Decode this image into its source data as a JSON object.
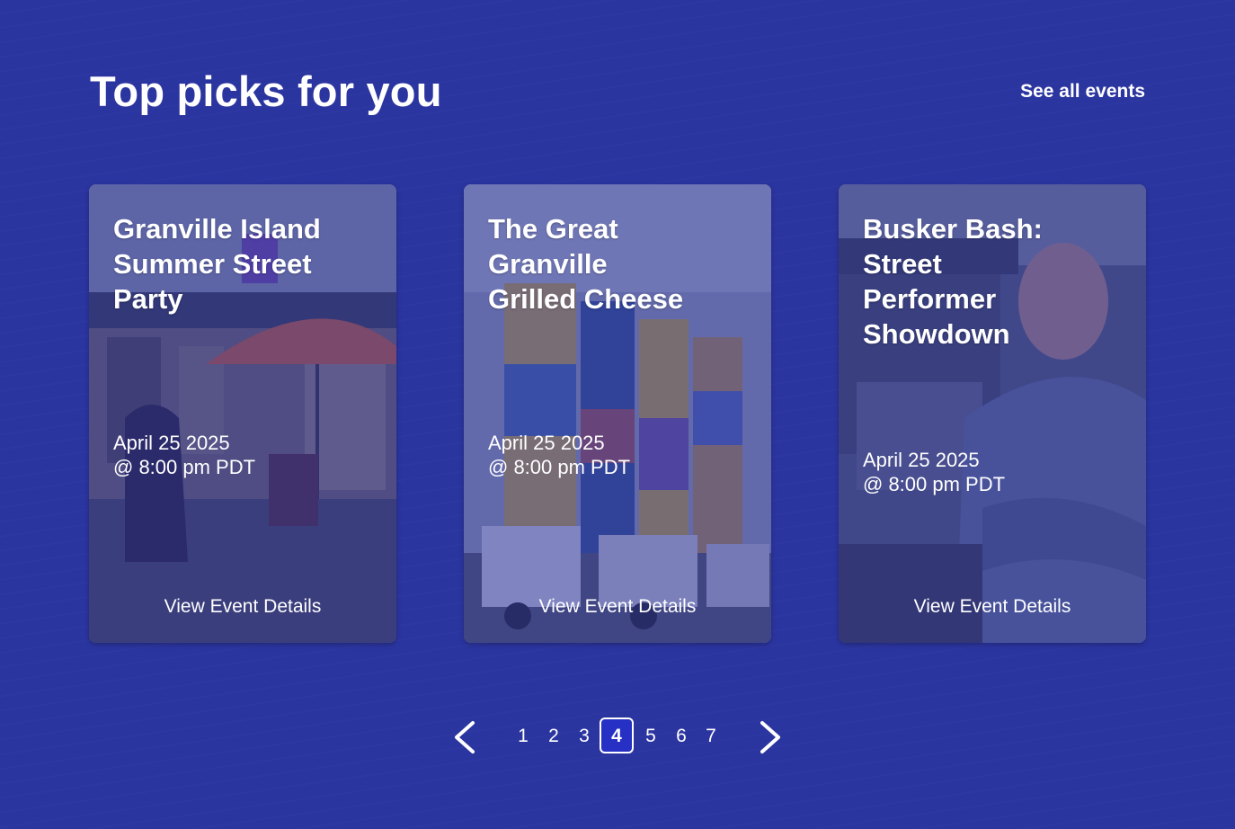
{
  "section": {
    "title": "Top picks for you",
    "see_all_label": "See all events"
  },
  "cards": [
    {
      "title_lines": [
        "Granville Island",
        "Summer Street",
        "Party"
      ],
      "date": "April 25 2025",
      "time": "@ 8:00 pm PDT",
      "link_label": "View Event Details",
      "image_desc": "market-street-umbrella-photo"
    },
    {
      "title_lines": [
        "The Great",
        "Granville",
        "Grilled Cheese"
      ],
      "date": "April 25 2025",
      "time": "@ 8:00 pm PDT",
      "link_label": "View Event Details",
      "image_desc": "painted-silos-photo"
    },
    {
      "title_lines": [
        "Busker Bash:",
        "Street",
        "Performer",
        "Showdown"
      ],
      "date": "April 25 2025",
      "time": "@ 8:00 pm PDT",
      "link_label": "View Event Details",
      "image_desc": "smiling-man-photo"
    }
  ],
  "pagination": {
    "prev_icon": "chevron-left-icon",
    "next_icon": "chevron-right-icon",
    "pages": [
      "1",
      "2",
      "3",
      "4",
      "5",
      "6",
      "7"
    ],
    "current": "4"
  },
  "colors": {
    "background": "#2b35a0",
    "active_page": "#2630c4",
    "text": "#ffffff"
  }
}
